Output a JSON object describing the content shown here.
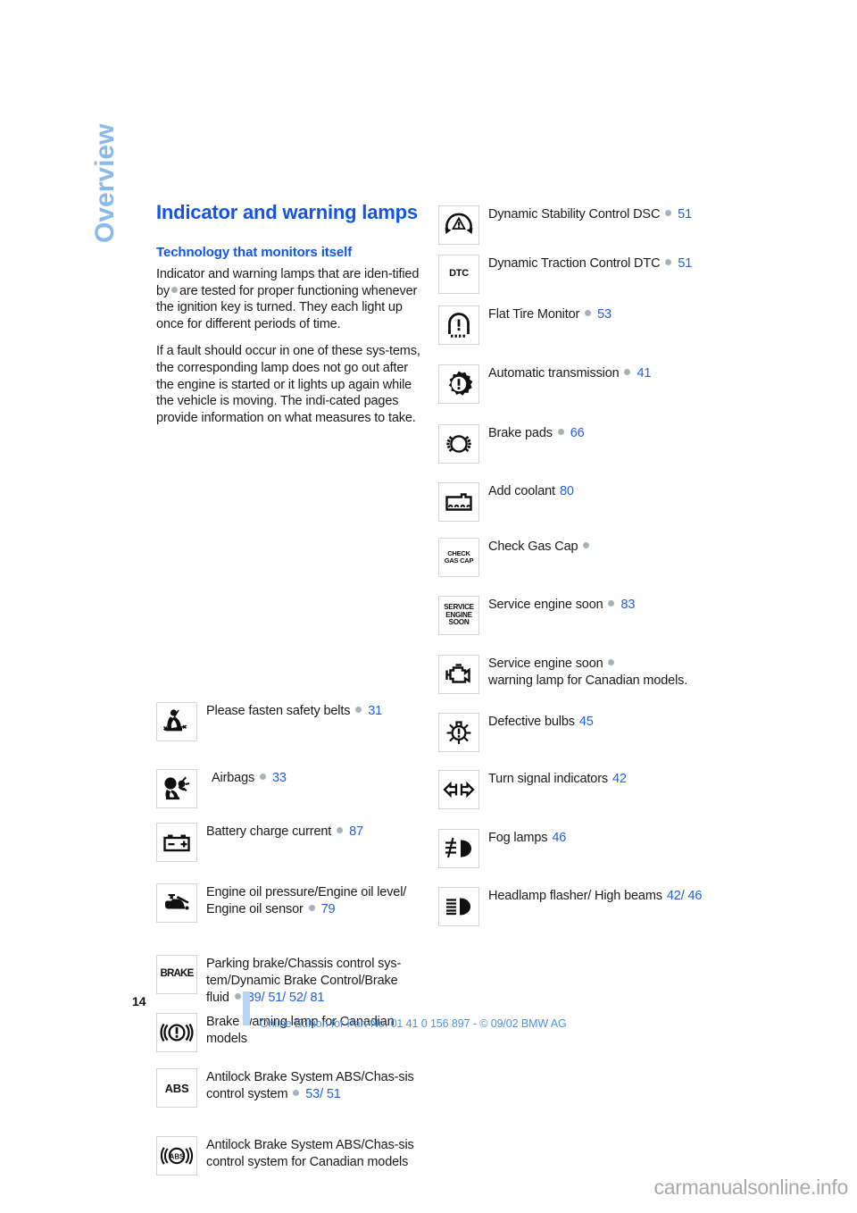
{
  "section_tab": "Overview",
  "title": "Indicator and warning lamps",
  "subtitle": "Technology that monitors itself",
  "intro": {
    "p1_a": "Indicator and warning lamps that are iden-tified by",
    "p1_b": "are tested for proper functioning whenever the ignition key is turned. They each light up once for different periods of time.",
    "p2": "If a fault should occur in one of these sys-tems, the corresponding lamp does not go out after the engine is started or it lights up again while the vehicle is moving. The indi-cated pages provide information on what measures to take."
  },
  "left_column": [
    {
      "icon": "seatbelt-icon",
      "label": "Please fasten safety belts",
      "has_dot": true,
      "pages": "31"
    },
    {
      "icon": "airbag-icon",
      "label": "Airbags",
      "has_dot": true,
      "pages": "33",
      "indent": true
    },
    {
      "icon": "battery-icon",
      "label": "Battery charge current",
      "has_dot": true,
      "pages": "87"
    },
    {
      "icon": "engine-oil-icon",
      "label": "Engine oil pressure/Engine oil level/ Engine oil sensor",
      "has_dot": true,
      "pages": "79"
    },
    {
      "icon": "brake-text-icon",
      "icon_text": "BRAKE",
      "label": "Parking brake/Chassis control sys-tem/Dynamic Brake Control/Brake fluid",
      "has_dot": true,
      "pages": "39/ 51/ 52/ 81"
    },
    {
      "icon": "brake-warning-canadian-icon",
      "label": "Brake warning lamp for Canadian models",
      "has_dot": false,
      "pages": ""
    },
    {
      "icon": "abs-text-icon",
      "icon_text": "ABS",
      "label": "Antilock Brake System ABS/Chas-sis control system",
      "has_dot": true,
      "pages": "53/ 51"
    },
    {
      "icon": "abs-canadian-icon",
      "label": "Antilock Brake System ABS/Chas-sis control system for Canadian models",
      "has_dot": false,
      "pages": ""
    }
  ],
  "right_column": [
    {
      "icon": "dsc-icon",
      "label": "Dynamic Stability Control DSC",
      "has_dot": true,
      "pages": "51"
    },
    {
      "icon": "dtc-text-icon",
      "icon_text": "DTC",
      "label": "Dynamic Traction Control DTC",
      "has_dot": true,
      "pages": "51"
    },
    {
      "icon": "flat-tire-monitor-icon",
      "label": "Flat Tire Monitor",
      "has_dot": true,
      "pages": "53"
    },
    {
      "icon": "automatic-transmission-icon",
      "label": "Automatic transmission",
      "has_dot": true,
      "pages": "41"
    },
    {
      "icon": "brake-pads-icon",
      "label": "Brake pads",
      "has_dot": true,
      "pages": "66"
    },
    {
      "icon": "add-coolant-icon",
      "label": "Add coolant",
      "has_dot": false,
      "pages": "80"
    },
    {
      "icon": "check-gas-cap-text-icon",
      "icon_text": "CHECK GAS CAP",
      "label": "Check Gas Cap",
      "has_dot": true,
      "pages": ""
    },
    {
      "icon": "service-engine-soon-text-icon",
      "icon_text": "SERVICE ENGINE SOON",
      "label": "Service engine soon",
      "has_dot": true,
      "pages": "83"
    },
    {
      "icon": "engine-outline-icon",
      "label": "Service engine soon",
      "label_rest": "warning lamp for Canadian models.",
      "has_dot": true,
      "pages": ""
    },
    {
      "icon": "defective-bulbs-icon",
      "label": "Defective bulbs",
      "has_dot": false,
      "pages": "45"
    },
    {
      "icon": "turn-signal-icon",
      "label": "Turn signal indicators",
      "has_dot": false,
      "pages": "42"
    },
    {
      "icon": "fog-lamp-icon",
      "label": "Fog lamps",
      "has_dot": false,
      "pages": "46"
    },
    {
      "icon": "high-beam-icon",
      "label": "Headlamp flasher/ High beams",
      "has_dot": false,
      "pages": "42/ 46"
    }
  ],
  "footer": {
    "page_number": "14",
    "online_edition": "Online Edition for Part-No. 01 41 0 156 897 - © 09/02 BMW AG"
  },
  "watermark": "carmanualsonline.info",
  "colors": {
    "heading_blue": "#0f55ea",
    "link_blue": "#1f5fe0",
    "tab_blue": "#8ab9ea",
    "footer_blue": "#4f8fe0",
    "bullet_gray": "#a9b2bb"
  }
}
